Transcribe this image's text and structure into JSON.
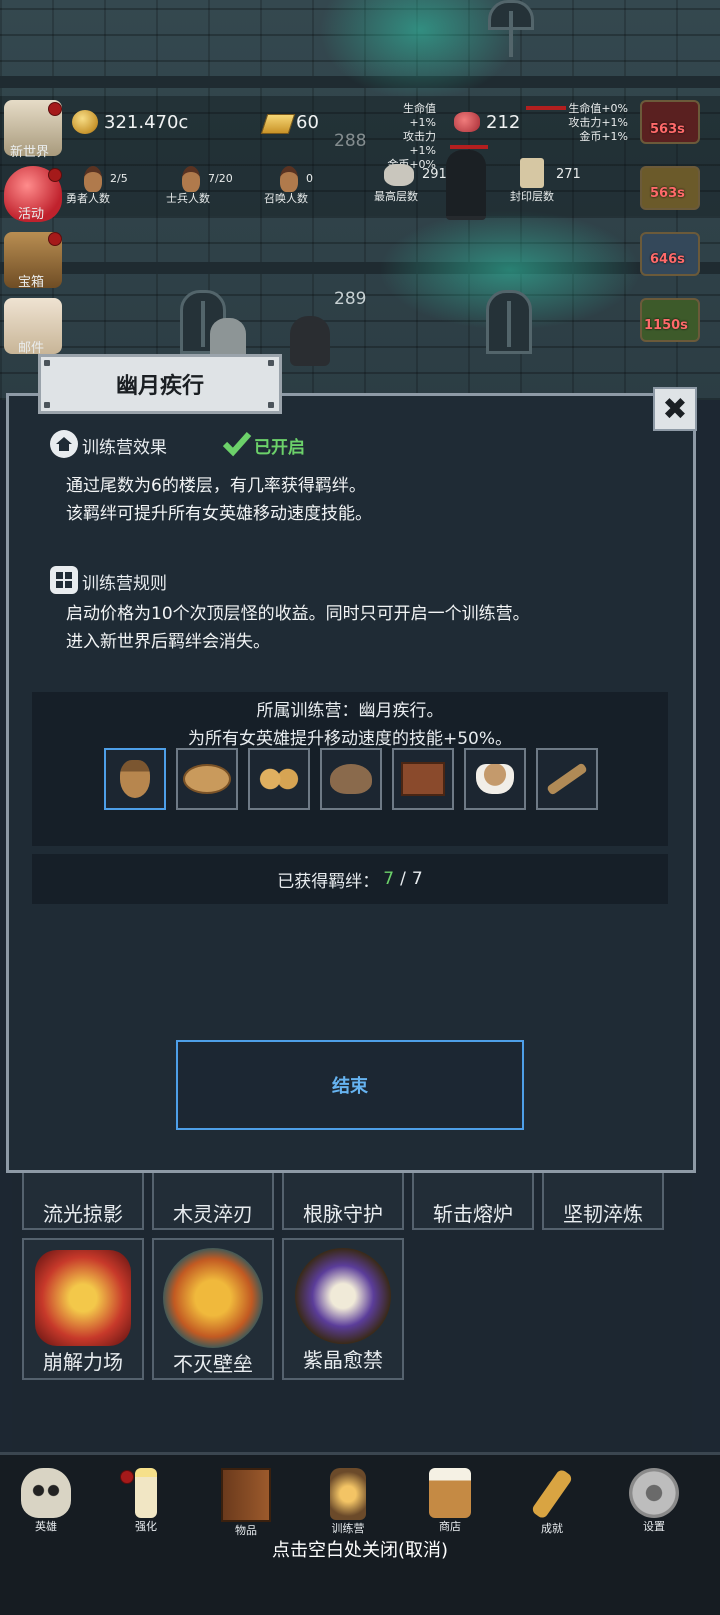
{
  "side_menu": [
    {
      "label": "新世界",
      "icon": "world-map-icon",
      "badge": true
    },
    {
      "label": "活动",
      "icon": "heart-icon",
      "badge": true
    },
    {
      "label": "宝箱",
      "icon": "treasure-chest-icon",
      "badge": true
    },
    {
      "label": "邮件",
      "icon": "mail-icon",
      "badge": false
    }
  ],
  "resources": {
    "coins": "321.470c",
    "gold_bars": "60",
    "meat": "212"
  },
  "buffs_left": [
    "生命值+1%",
    "攻击力+1%",
    "金币+0%"
  ],
  "buffs_right": [
    "生命值+0%",
    "攻击力+1%",
    "金币+1%"
  ],
  "counts": [
    {
      "value": "2/5",
      "label": "勇者人数"
    },
    {
      "value": "7/20",
      "label": "士兵人数"
    },
    {
      "value": "0",
      "label": "召唤人数"
    },
    {
      "value": "291",
      "label": "最高层数"
    },
    {
      "value": "271",
      "label": "封印层数"
    }
  ],
  "floors": {
    "upper": "288",
    "lower": "289"
  },
  "right_timers": [
    "563s",
    "563s",
    "646s",
    "1150s"
  ],
  "modal": {
    "title": "幽月疾行",
    "effect_heading": "训练营效果",
    "status": "已开启",
    "effect_lines": [
      "通过尾数为6的楼层，有几率获得羁绊。",
      "该羁绊可提升所有女英雄移动速度技能。"
    ],
    "rules_heading": "训练营规则",
    "rules_lines": [
      "启动价格为10个次顶层怪的收益。同时只可开启一个训练营。",
      "进入新世界后羁绊会消失。"
    ],
    "camp_line": "所属训练营：幽月疾行。",
    "bonus_line": "为所有女英雄提升移动速度的技能+50%。",
    "bond_items": [
      "acorn-icon",
      "bread-icon",
      "cookies-icon",
      "flour-bowl-icon",
      "chocolate-icon",
      "coffee-cup-icon",
      "branch-icon"
    ],
    "obtained_label": "已获得羁绊：",
    "obtained_current": "7",
    "obtained_sep": "/",
    "obtained_total": "7",
    "end_button": "结束",
    "colors": {
      "accent": "#4e9fe8",
      "enabled": "#6cd16a"
    }
  },
  "skills": [
    "流光掠影",
    "木灵淬刃",
    "根脉守护",
    "斩击熔炉",
    "坚韧淬炼",
    "崩解力场",
    "不灭壁垒",
    "紫晶愈禁"
  ],
  "nav": [
    {
      "label": "英雄",
      "icon": "skull-icon",
      "badge": false
    },
    {
      "label": "强化",
      "icon": "candle-icon",
      "badge": true
    },
    {
      "label": "物品",
      "icon": "book-icon",
      "badge": false
    },
    {
      "label": "训练营",
      "icon": "lantern-icon",
      "badge": false
    },
    {
      "label": "商店",
      "icon": "beer-mug-icon",
      "badge": false
    },
    {
      "label": "成就",
      "icon": "key-icon",
      "badge": false
    },
    {
      "label": "设置",
      "icon": "gear-icon",
      "badge": false
    }
  ],
  "close_hint": "点击空白处关闭(取消)"
}
